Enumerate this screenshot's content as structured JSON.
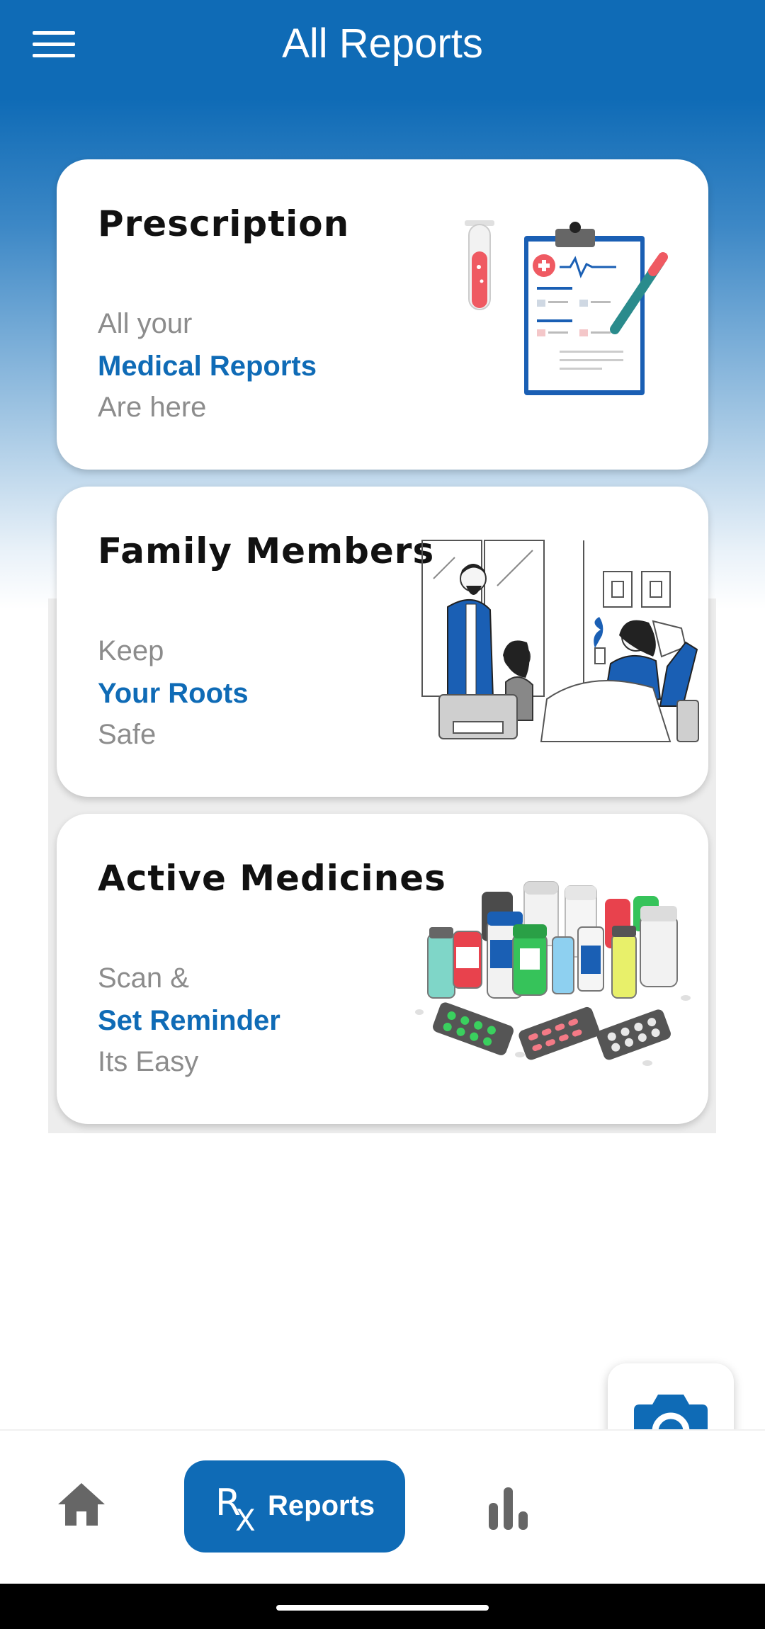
{
  "app_bar": {
    "title": "All Reports"
  },
  "cards": [
    {
      "title": "Prescription",
      "line1": "All your",
      "highlight": "Medical Reports",
      "line3": "Are here"
    },
    {
      "title": "Family Members",
      "line1": "Keep",
      "highlight": "Your Roots",
      "line3": "Safe"
    },
    {
      "title": "Active Medicines",
      "line1": "Scan &",
      "highlight": "Set Reminder",
      "line3": "Its Easy"
    }
  ],
  "bottom_nav": {
    "home_icon": "home-icon",
    "reports_label": "Reports",
    "reports_icon_r": "R",
    "reports_icon_x": "X",
    "stats_icon": "bar-chart-icon"
  },
  "fab": {
    "icon": "camera-icon"
  },
  "colors": {
    "primary": "#0f6bb6",
    "text_muted": "#8c8c8c",
    "card_bg": "#ffffff"
  }
}
